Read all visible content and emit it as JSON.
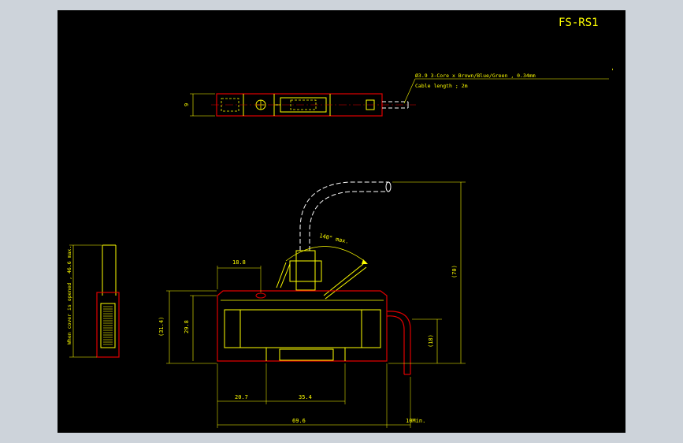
{
  "drawing": {
    "title": "FS-RS1",
    "cable_note": "Ø3.9 3-Core x Brown/Blue/Green , 0.34mm",
    "cable_length": "Cable length ; 2m",
    "side_label": "When cover is opened , 46.6 max.",
    "top_height": "9",
    "angle_label": "140° max.",
    "dim_left_offset": "18.8",
    "dim_height_outer": "(31.4)",
    "dim_height_inner": "29.8",
    "dim_total_height": "(70)",
    "dim_cable_height": "(18)",
    "dim_bottom_left": "20.7",
    "dim_bottom_mid": "35.4",
    "dim_total_width": "69.6",
    "dim_bend_min": "10Min."
  },
  "colors": {
    "background": "#000000",
    "frame": "#cdd3da",
    "outline_red": "#e00000",
    "detail_yellow": "#ffff00",
    "cable_white": "#ffffff",
    "title_text": "#ffff00"
  }
}
